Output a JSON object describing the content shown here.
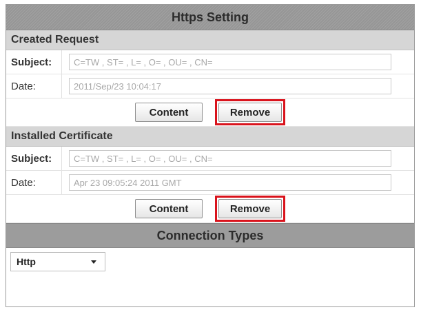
{
  "title": "Https Setting",
  "created_request": {
    "heading": "Created Request",
    "subject_label": "Subject:",
    "subject_value": "C=TW , ST= , L= , O= , OU= , CN=",
    "date_label": "Date:",
    "date_value": "2011/Sep/23 10:04:17",
    "content_button": "Content",
    "remove_button": "Remove"
  },
  "installed_certificate": {
    "heading": "Installed Certificate",
    "subject_label": "Subject:",
    "subject_value": "C=TW , ST= , L= , O= , OU= , CN=",
    "date_label": "Date:",
    "date_value": "Apr 23 09:05:24 2011 GMT",
    "content_button": "Content",
    "remove_button": "Remove"
  },
  "connection_types": {
    "heading": "Connection Types",
    "selected": "Http",
    "icon": "chevron-down-icon"
  },
  "colors": {
    "highlight": "#d9131c",
    "title_bar": "#9c9c9c",
    "section_bar": "#d6d6d6"
  }
}
